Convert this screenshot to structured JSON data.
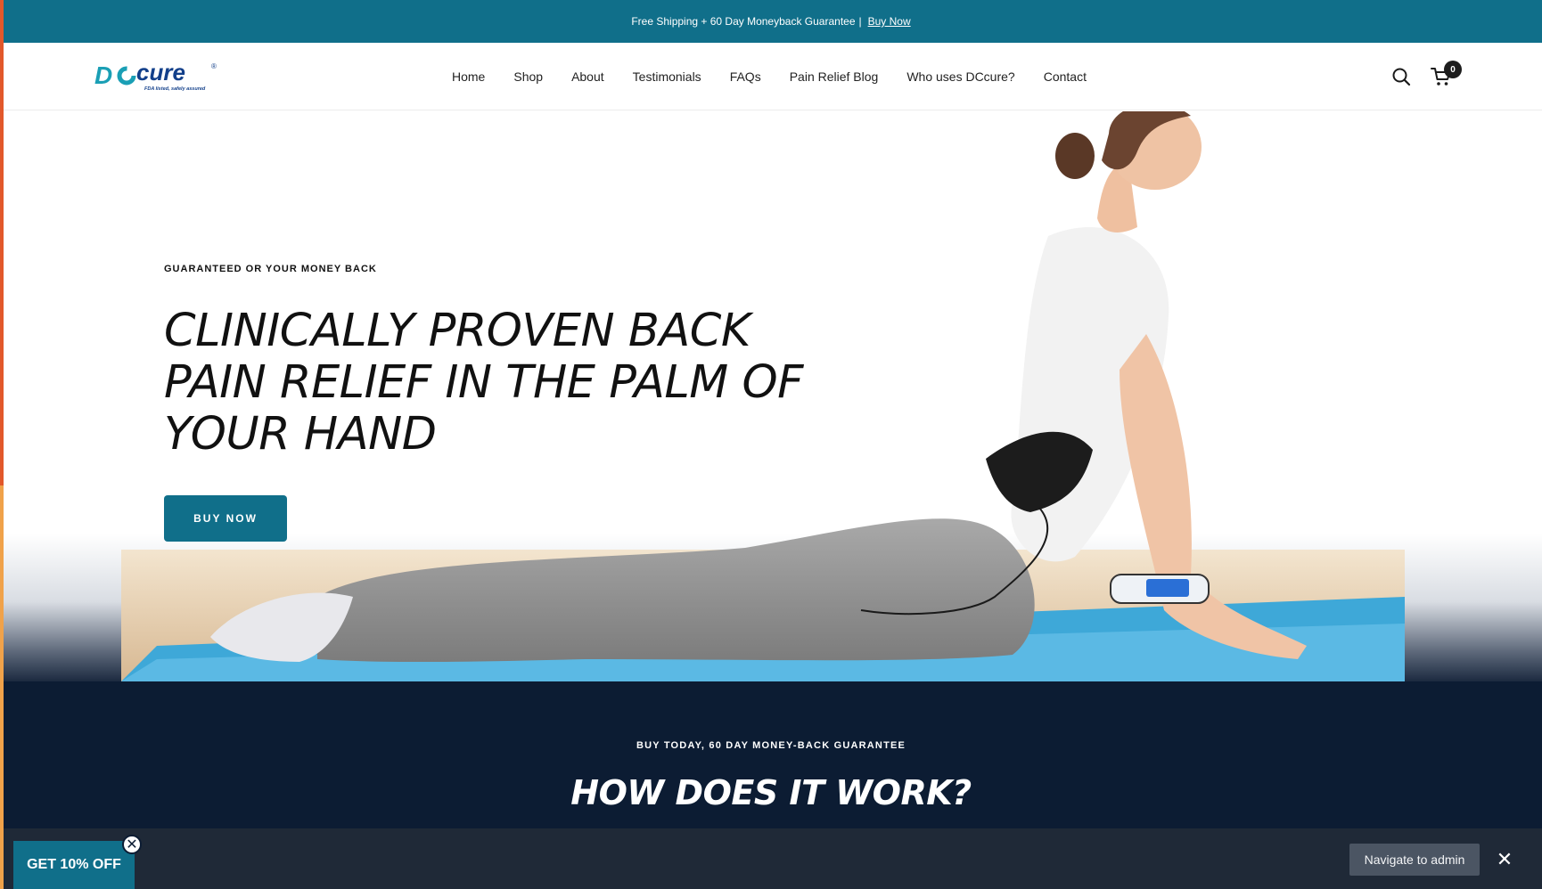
{
  "announcement": {
    "text": "Free Shipping + 60 Day Moneyback Guarantee",
    "separator": "|",
    "link": "Buy Now"
  },
  "brand": {
    "logo_text_1": "D",
    "logo_text_2": "cure",
    "registered": "®",
    "tagline": "FDA listed, safely assured"
  },
  "nav": {
    "items": [
      "Home",
      "Shop",
      "About",
      "Testimonials",
      "FAQs",
      "Pain Relief Blog",
      "Who uses DCcure?",
      "Contact"
    ]
  },
  "cart": {
    "count": "0"
  },
  "hero": {
    "eyebrow": "GUARANTEED OR YOUR MONEY BACK",
    "title": "CLINICALLY PROVEN BACK PAIN RELIEF IN THE PALM OF YOUR HAND",
    "button": "BUY NOW"
  },
  "how_it_works": {
    "eyebrow": "BUY TODAY, 60 DAY MONEY-BACK GUARANTEE",
    "title": "HOW DOES IT WORK?"
  },
  "popups": {
    "discount": "GET 10% OFF",
    "close_symbol": "✕",
    "admin": "Navigate to admin",
    "admin_close_symbol": "✕"
  },
  "colors": {
    "brand_teal": "#106f8a",
    "dark_navy": "#0c1c33",
    "admin_bar": "#1f2937"
  }
}
